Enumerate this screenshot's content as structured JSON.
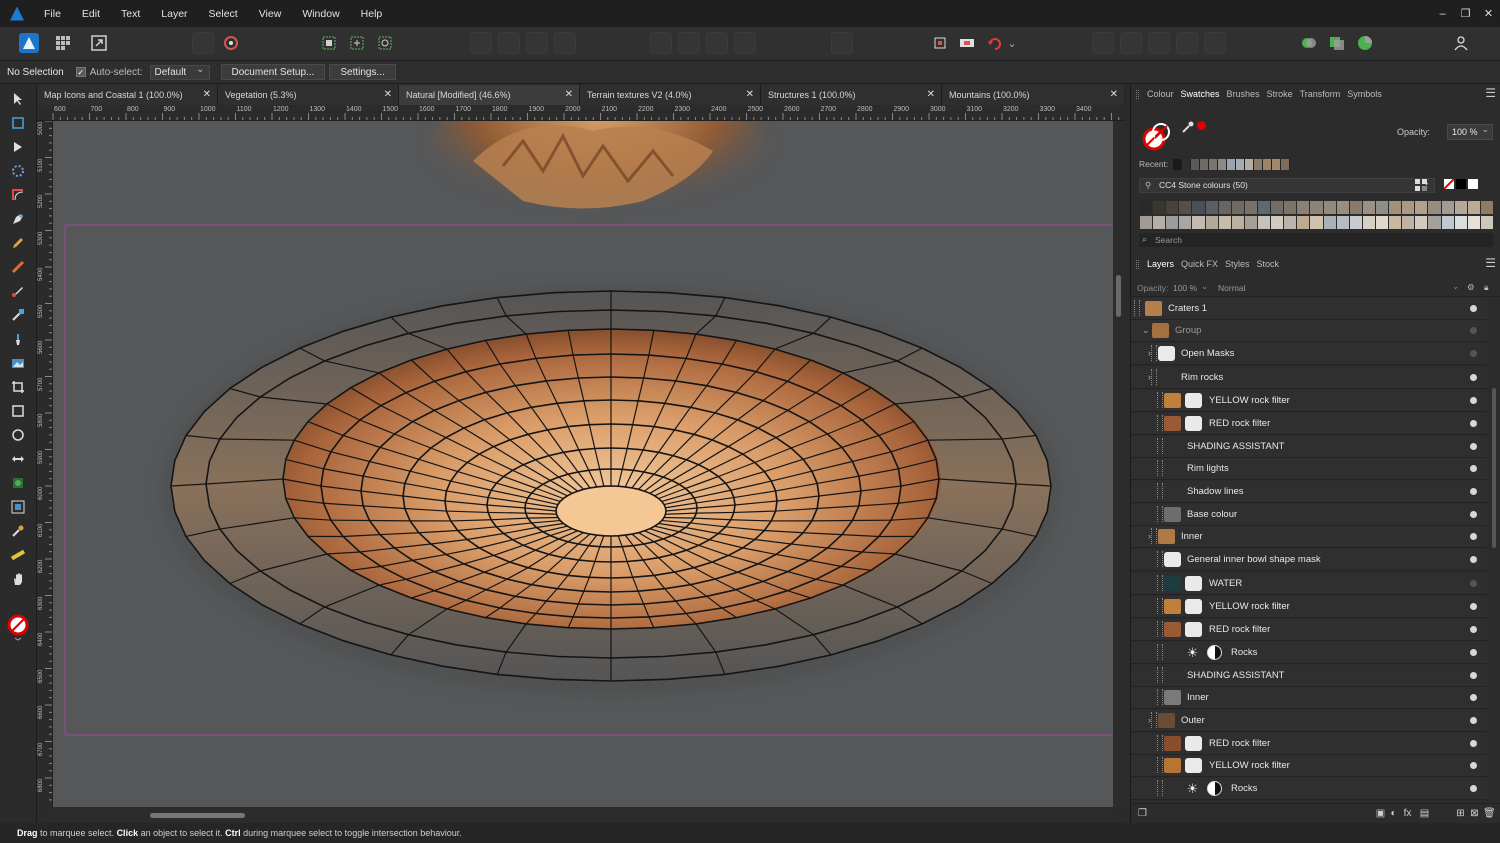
{
  "menu": [
    "File",
    "Edit",
    "Text",
    "Layer",
    "Select",
    "View",
    "Window",
    "Help"
  ],
  "window_controls": [
    "–",
    "❐",
    "✕"
  ],
  "context": {
    "selection": "No Selection",
    "autoselect_label": "Auto-select:",
    "autoselect_value": "Default",
    "document_setup": "Document Setup...",
    "settings": "Settings..."
  },
  "tabs": [
    {
      "label": "Map Icons and Coastal 1 (100.0%)"
    },
    {
      "label": "Vegetation (5.3%)"
    },
    {
      "label": "Natural [Modified] (46.6%)"
    },
    {
      "label": "Terrain textures V2 (4.0%)"
    },
    {
      "label": "Structures 1 (100.0%)"
    },
    {
      "label": "Mountains (100.0%)"
    }
  ],
  "ruler_h": [
    "600",
    "700",
    "800",
    "900",
    "1000",
    "1100",
    "1200",
    "1300",
    "1400",
    "1500",
    "1600",
    "1700",
    "1800",
    "1900",
    "2000",
    "2100",
    "2200",
    "2300",
    "2400",
    "2500",
    "2600",
    "2700",
    "2800",
    "2900",
    "3000",
    "3100",
    "3200",
    "3300",
    "3400"
  ],
  "ruler_v": [
    "5000",
    "5100",
    "5200",
    "5300",
    "5400",
    "5500",
    "5600",
    "5700",
    "5800",
    "5900",
    "6000",
    "6100",
    "6200",
    "6300",
    "6400",
    "6500",
    "6600",
    "6700",
    "6800"
  ],
  "swatches_panel": {
    "tabs": [
      "Colour",
      "Swatches",
      "Brushes",
      "Stroke",
      "Transform",
      "Symbols"
    ],
    "opacity_label": "Opacity:",
    "opacity_value": "100 %",
    "recent_label": "Recent:",
    "palette_name": "CC4 Stone colours (50)",
    "search_placeholder": "Search",
    "current_color": "#e00000",
    "recent_colors": [
      "#1a1a1a",
      "#2e2e2e",
      "#5a5a5a",
      "#6e6a64",
      "#7a756c",
      "#8c8a86",
      "#9aa3ad",
      "#a5acb3",
      "#b2aea6",
      "#8a7a68",
      "#9c8466",
      "#a08a6e",
      "#7d6c58"
    ],
    "palette_colors": [
      "#2a2a2a",
      "#3a3632",
      "#48423b",
      "#55504a",
      "#4a4f55",
      "#5b5f63",
      "#6a6560",
      "#6f6a5f",
      "#77716a",
      "#5d6a72",
      "#706e6a",
      "#7e7466",
      "#8b8073",
      "#8e8378",
      "#93897c",
      "#9a8e81",
      "#897a69",
      "#9c9085",
      "#8f8d89",
      "#a09278",
      "#aa9a85",
      "#b0a08c",
      "#968c82",
      "#a39a90",
      "#b3a899",
      "#b9ab95",
      "#8f7b62",
      "#a09b95",
      "#b5afa8",
      "#9d9c9a",
      "#a8a7a3",
      "#c0bab2",
      "#b4a89a",
      "#c7bcab",
      "#bdb0a0",
      "#a89e94",
      "#c5c1bb",
      "#d2cbc0",
      "#b9b3ab",
      "#c0aa8f",
      "#d1c2ad",
      "#a8b0b8",
      "#b7bcc0",
      "#c8ccd0",
      "#d6cfc3",
      "#e0d8cc",
      "#c9b79f",
      "#bfb2a4",
      "#d3cabd",
      "#a6a09a",
      "#c2c8cf",
      "#d9dde0",
      "#e6e1d8",
      "#cfc6ba"
    ]
  },
  "layers_panel": {
    "tabs": [
      "Layers",
      "Quick FX",
      "Styles",
      "Stock"
    ],
    "opacity_label": "Opacity:",
    "opacity_value": "100 %",
    "blend_mode": "Normal",
    "layers": [
      {
        "name": "Craters 1",
        "indent": 0,
        "thumb": "#b3804c",
        "visible": true
      },
      {
        "name": "Group",
        "indent": 1,
        "thumb": "#a66f3f",
        "visible": false
      },
      {
        "name": "Open Masks",
        "indent": 2,
        "thumb": "mask",
        "visible": false
      },
      {
        "name": "Rim rocks",
        "indent": 2,
        "thumb": "#2f2f2f",
        "visible": true
      },
      {
        "name": "YELLOW rock filter",
        "indent": 3,
        "thumb": "#c0803c",
        "mask": true,
        "visible": true
      },
      {
        "name": "RED rock filter",
        "indent": 3,
        "thumb": "#9a5a36",
        "mask": true,
        "visible": true
      },
      {
        "name": "SHADING ASSISTANT",
        "indent": 3,
        "thumb": "#2f2f2f",
        "visible": true
      },
      {
        "name": "Rim lights",
        "indent": 3,
        "thumb": "#2f2f2f",
        "visible": true
      },
      {
        "name": "Shadow lines",
        "indent": 3,
        "thumb": "#2f2f2f",
        "visible": true
      },
      {
        "name": "Base colour",
        "indent": 3,
        "thumb": "#6d6d6d",
        "visible": true
      },
      {
        "name": "Inner",
        "indent": 2,
        "thumb": "#b07a45",
        "visible": true
      },
      {
        "name": "General inner bowl shape mask",
        "indent": 3,
        "thumb": "mask",
        "visible": true
      },
      {
        "name": "WATER",
        "indent": 3,
        "thumb": "#1e3b3e",
        "mask": true,
        "visible": false
      },
      {
        "name": "YELLOW rock filter",
        "indent": 3,
        "thumb": "#c0803c",
        "mask": true,
        "visible": true
      },
      {
        "name": "RED rock filter",
        "indent": 3,
        "thumb": "#9a5a36",
        "mask": true,
        "visible": true
      },
      {
        "name": "Rocks",
        "indent": 3,
        "thumb": "#2f2f2f",
        "sun": true,
        "adj": true,
        "visible": true
      },
      {
        "name": "SHADING ASSISTANT",
        "indent": 3,
        "thumb": "#2f2f2f",
        "visible": true
      },
      {
        "name": "Inner",
        "indent": 3,
        "thumb": "#7a7a7a",
        "visible": true
      },
      {
        "name": "Outer",
        "indent": 2,
        "thumb": "#6a4b33",
        "visible": true
      },
      {
        "name": "RED rock filter",
        "indent": 3,
        "thumb": "#8a4d2e",
        "mask": true,
        "visible": true
      },
      {
        "name": "YELLOW rock filter",
        "indent": 3,
        "thumb": "#b87432",
        "mask": true,
        "visible": true
      },
      {
        "name": "Rocks",
        "indent": 3,
        "thumb": "#2f2f2f",
        "sun": true,
        "adj": true,
        "visible": true
      }
    ]
  },
  "status": {
    "drag": "Drag",
    "t1": " to marquee select. ",
    "click": "Click",
    "t2": " an object to select it. ",
    "ctrl": "Ctrl",
    "t3": " during marquee select to toggle intersection behaviour."
  }
}
